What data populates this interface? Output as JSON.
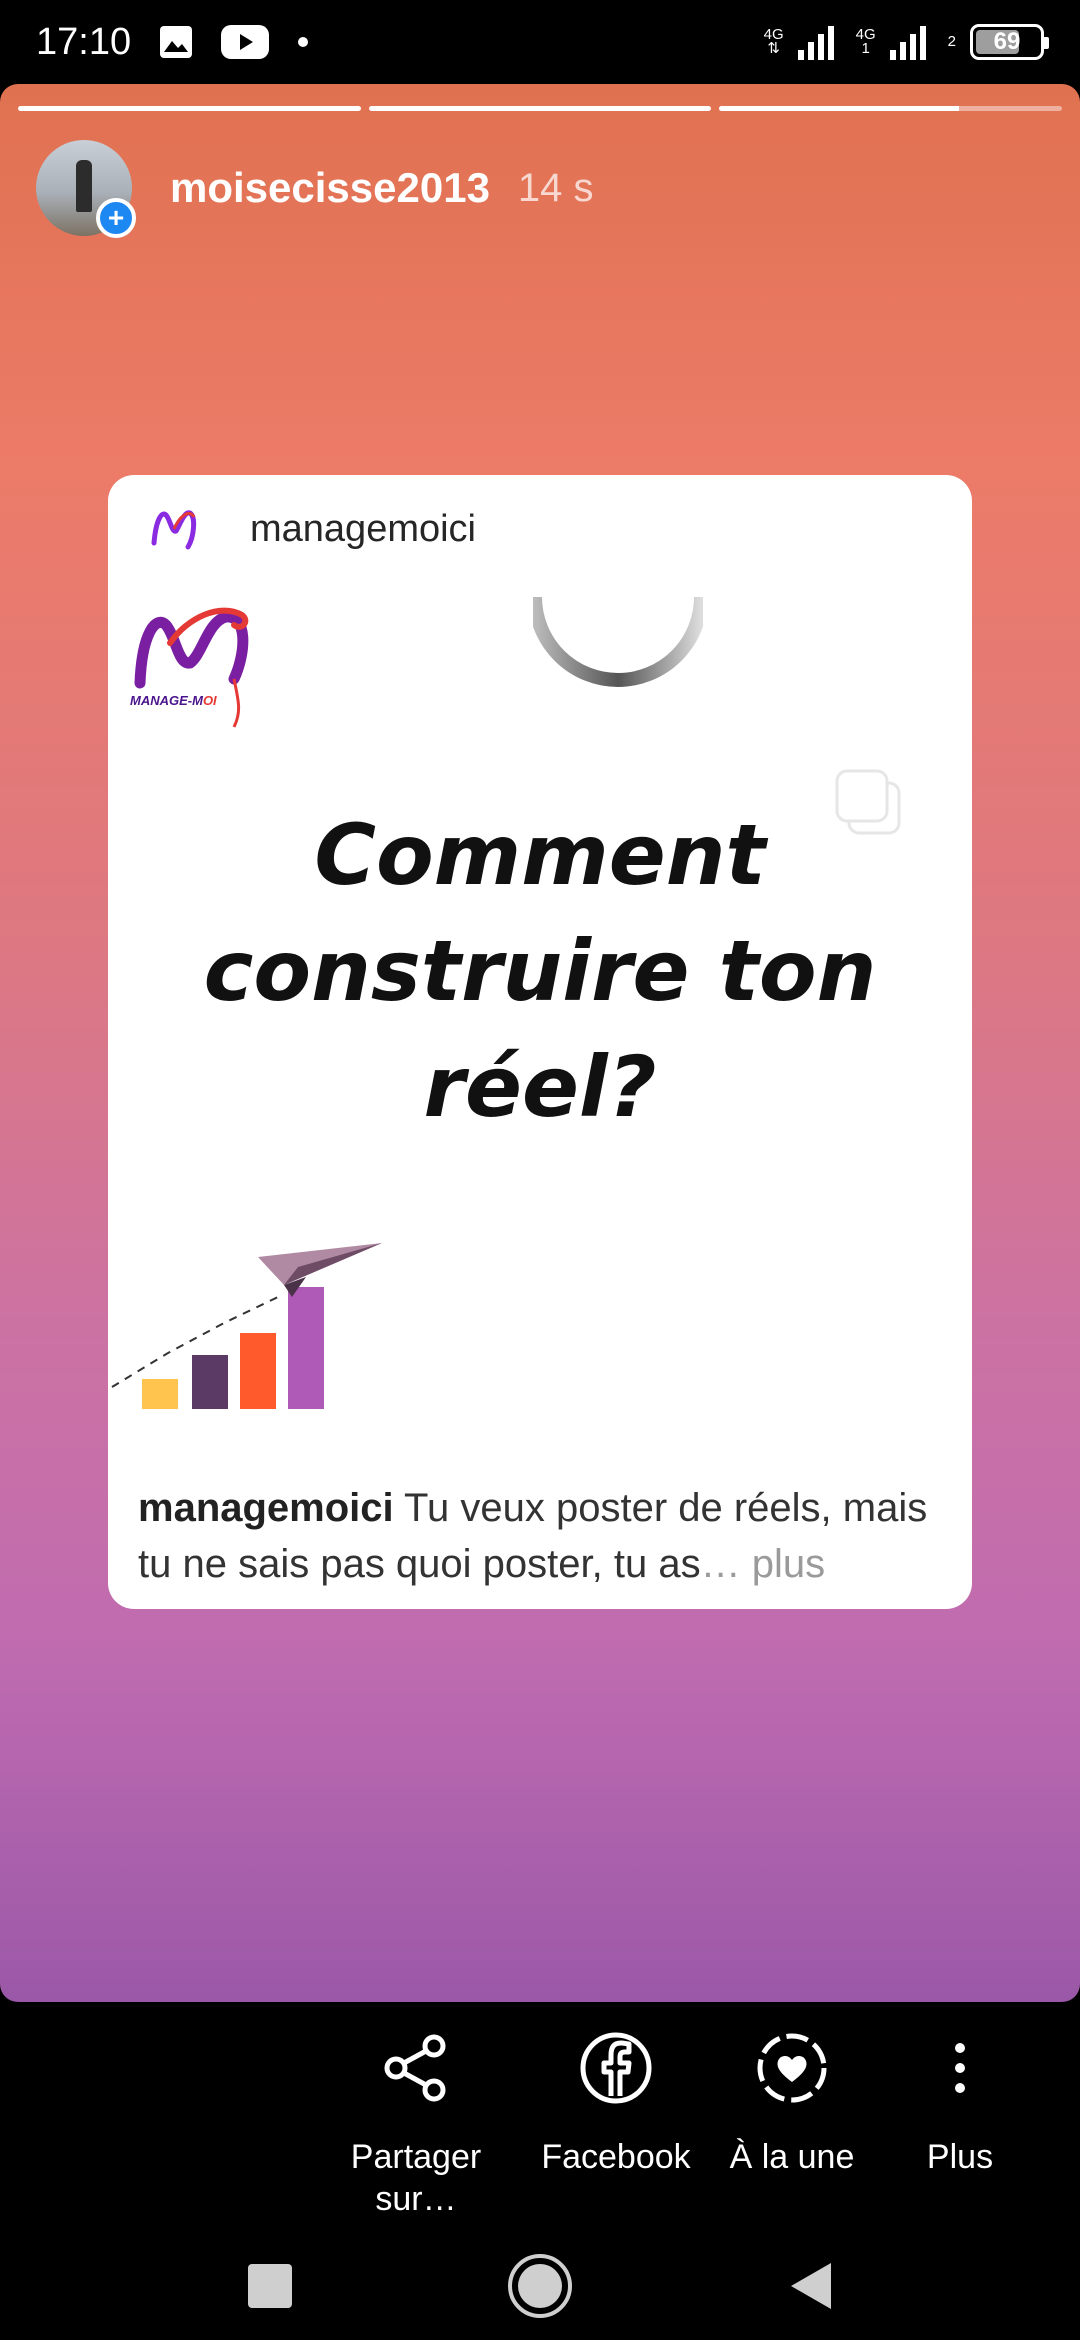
{
  "status_bar": {
    "time": "17:10",
    "network_1": "4G",
    "network_2": "4G",
    "sim_1": "1",
    "sim_2": "2",
    "battery": "69",
    "battery_fraction": 0.69
  },
  "story": {
    "progress": [
      1.0,
      1.0,
      0.7
    ],
    "username": "moisecisse2013",
    "time_ago": "14 s",
    "post": {
      "account": "managemoici",
      "headline_lines": [
        "Comment",
        "construire ton",
        "réel?"
      ],
      "caption_user": "managemoici",
      "caption_text": " Tu veux poster de réels, mais tu ne sais pas quoi poster, tu as",
      "caption_ellipsis": "…",
      "caption_more": " plus",
      "logo_text": "MANAGE-MOI"
    }
  },
  "actions": [
    {
      "label": "Partager sur…",
      "icon": "share-icon"
    },
    {
      "label": "Facebook",
      "icon": "facebook-icon"
    },
    {
      "label": "À la une",
      "icon": "highlight-heart-icon"
    },
    {
      "label": "Plus",
      "icon": "more-vertical-icon"
    }
  ],
  "navbar": {
    "recents": "square-icon",
    "home": "circle-icon",
    "back": "triangle-back-icon"
  },
  "colors": {
    "gradient_top": "#e07150",
    "gradient_bottom": "#9b58a8",
    "verified_blue": "#1e88f2"
  }
}
